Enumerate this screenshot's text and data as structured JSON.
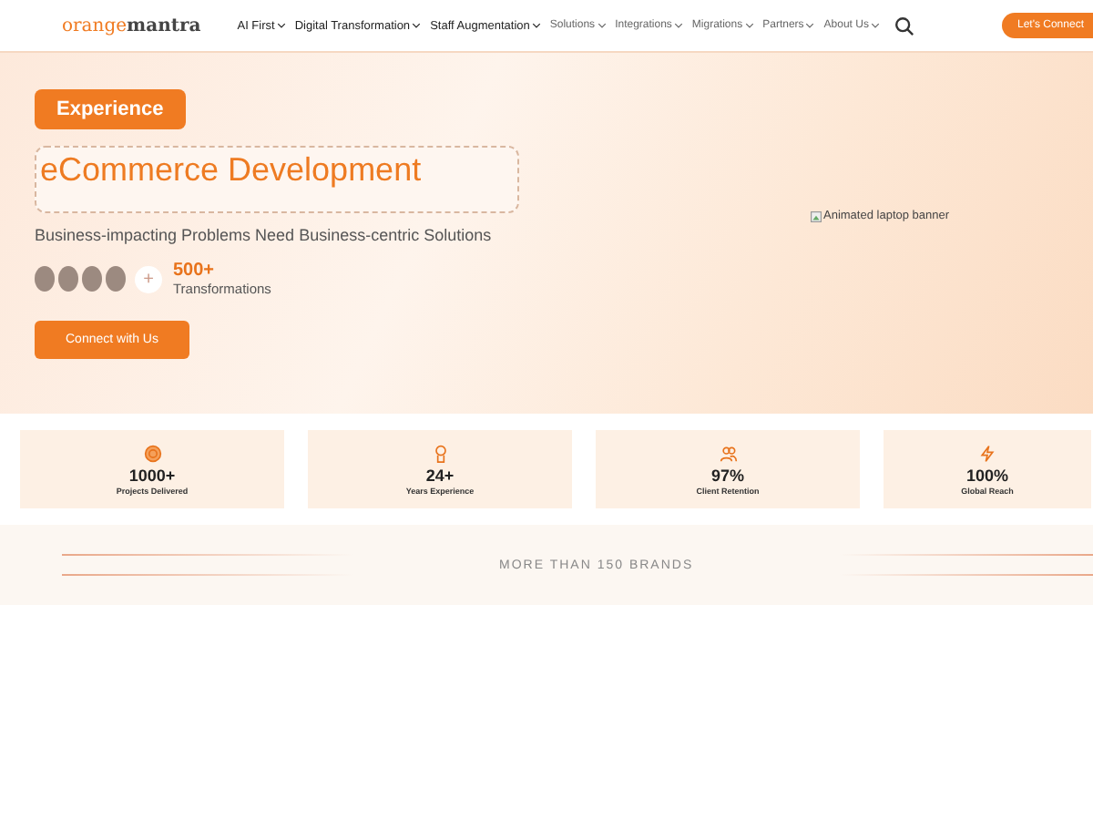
{
  "header": {
    "logo": {
      "part_1": "orange",
      "part_2": "mantra"
    },
    "nav": [
      {
        "label": "AI First",
        "strong": true
      },
      {
        "label": "Digital Transformation",
        "strong": true
      },
      {
        "label": "Staff Augmentation",
        "strong": true
      },
      {
        "label": "Solutions",
        "strong": false
      },
      {
        "label": "Integrations",
        "strong": false
      },
      {
        "label": "Migrations",
        "strong": false
      },
      {
        "label": "Partners",
        "strong": false
      },
      {
        "label": "About Us",
        "strong": false
      }
    ],
    "cta": "Let's Connect"
  },
  "hero": {
    "badge": "Experience",
    "title": "eCommerce Development",
    "subtitle": "Business-impacting Problems Need Business-centric Solutions",
    "count": "500+",
    "count_label": "Transformations",
    "plus": "+",
    "button": "Connect with Us",
    "image_alt": "Animated laptop banner"
  },
  "stats": [
    {
      "kind": "target",
      "value": "1000+",
      "label": "Projects Delivered"
    },
    {
      "kind": "award",
      "value": "24+",
      "label": "Years Experience"
    },
    {
      "kind": "users",
      "value": "97%",
      "label": "Client Retention"
    },
    {
      "kind": "bolt",
      "value": "100%",
      "label": "Global Reach"
    }
  ],
  "brands": {
    "heading": "MORE THAN 150 BRANDS"
  }
}
